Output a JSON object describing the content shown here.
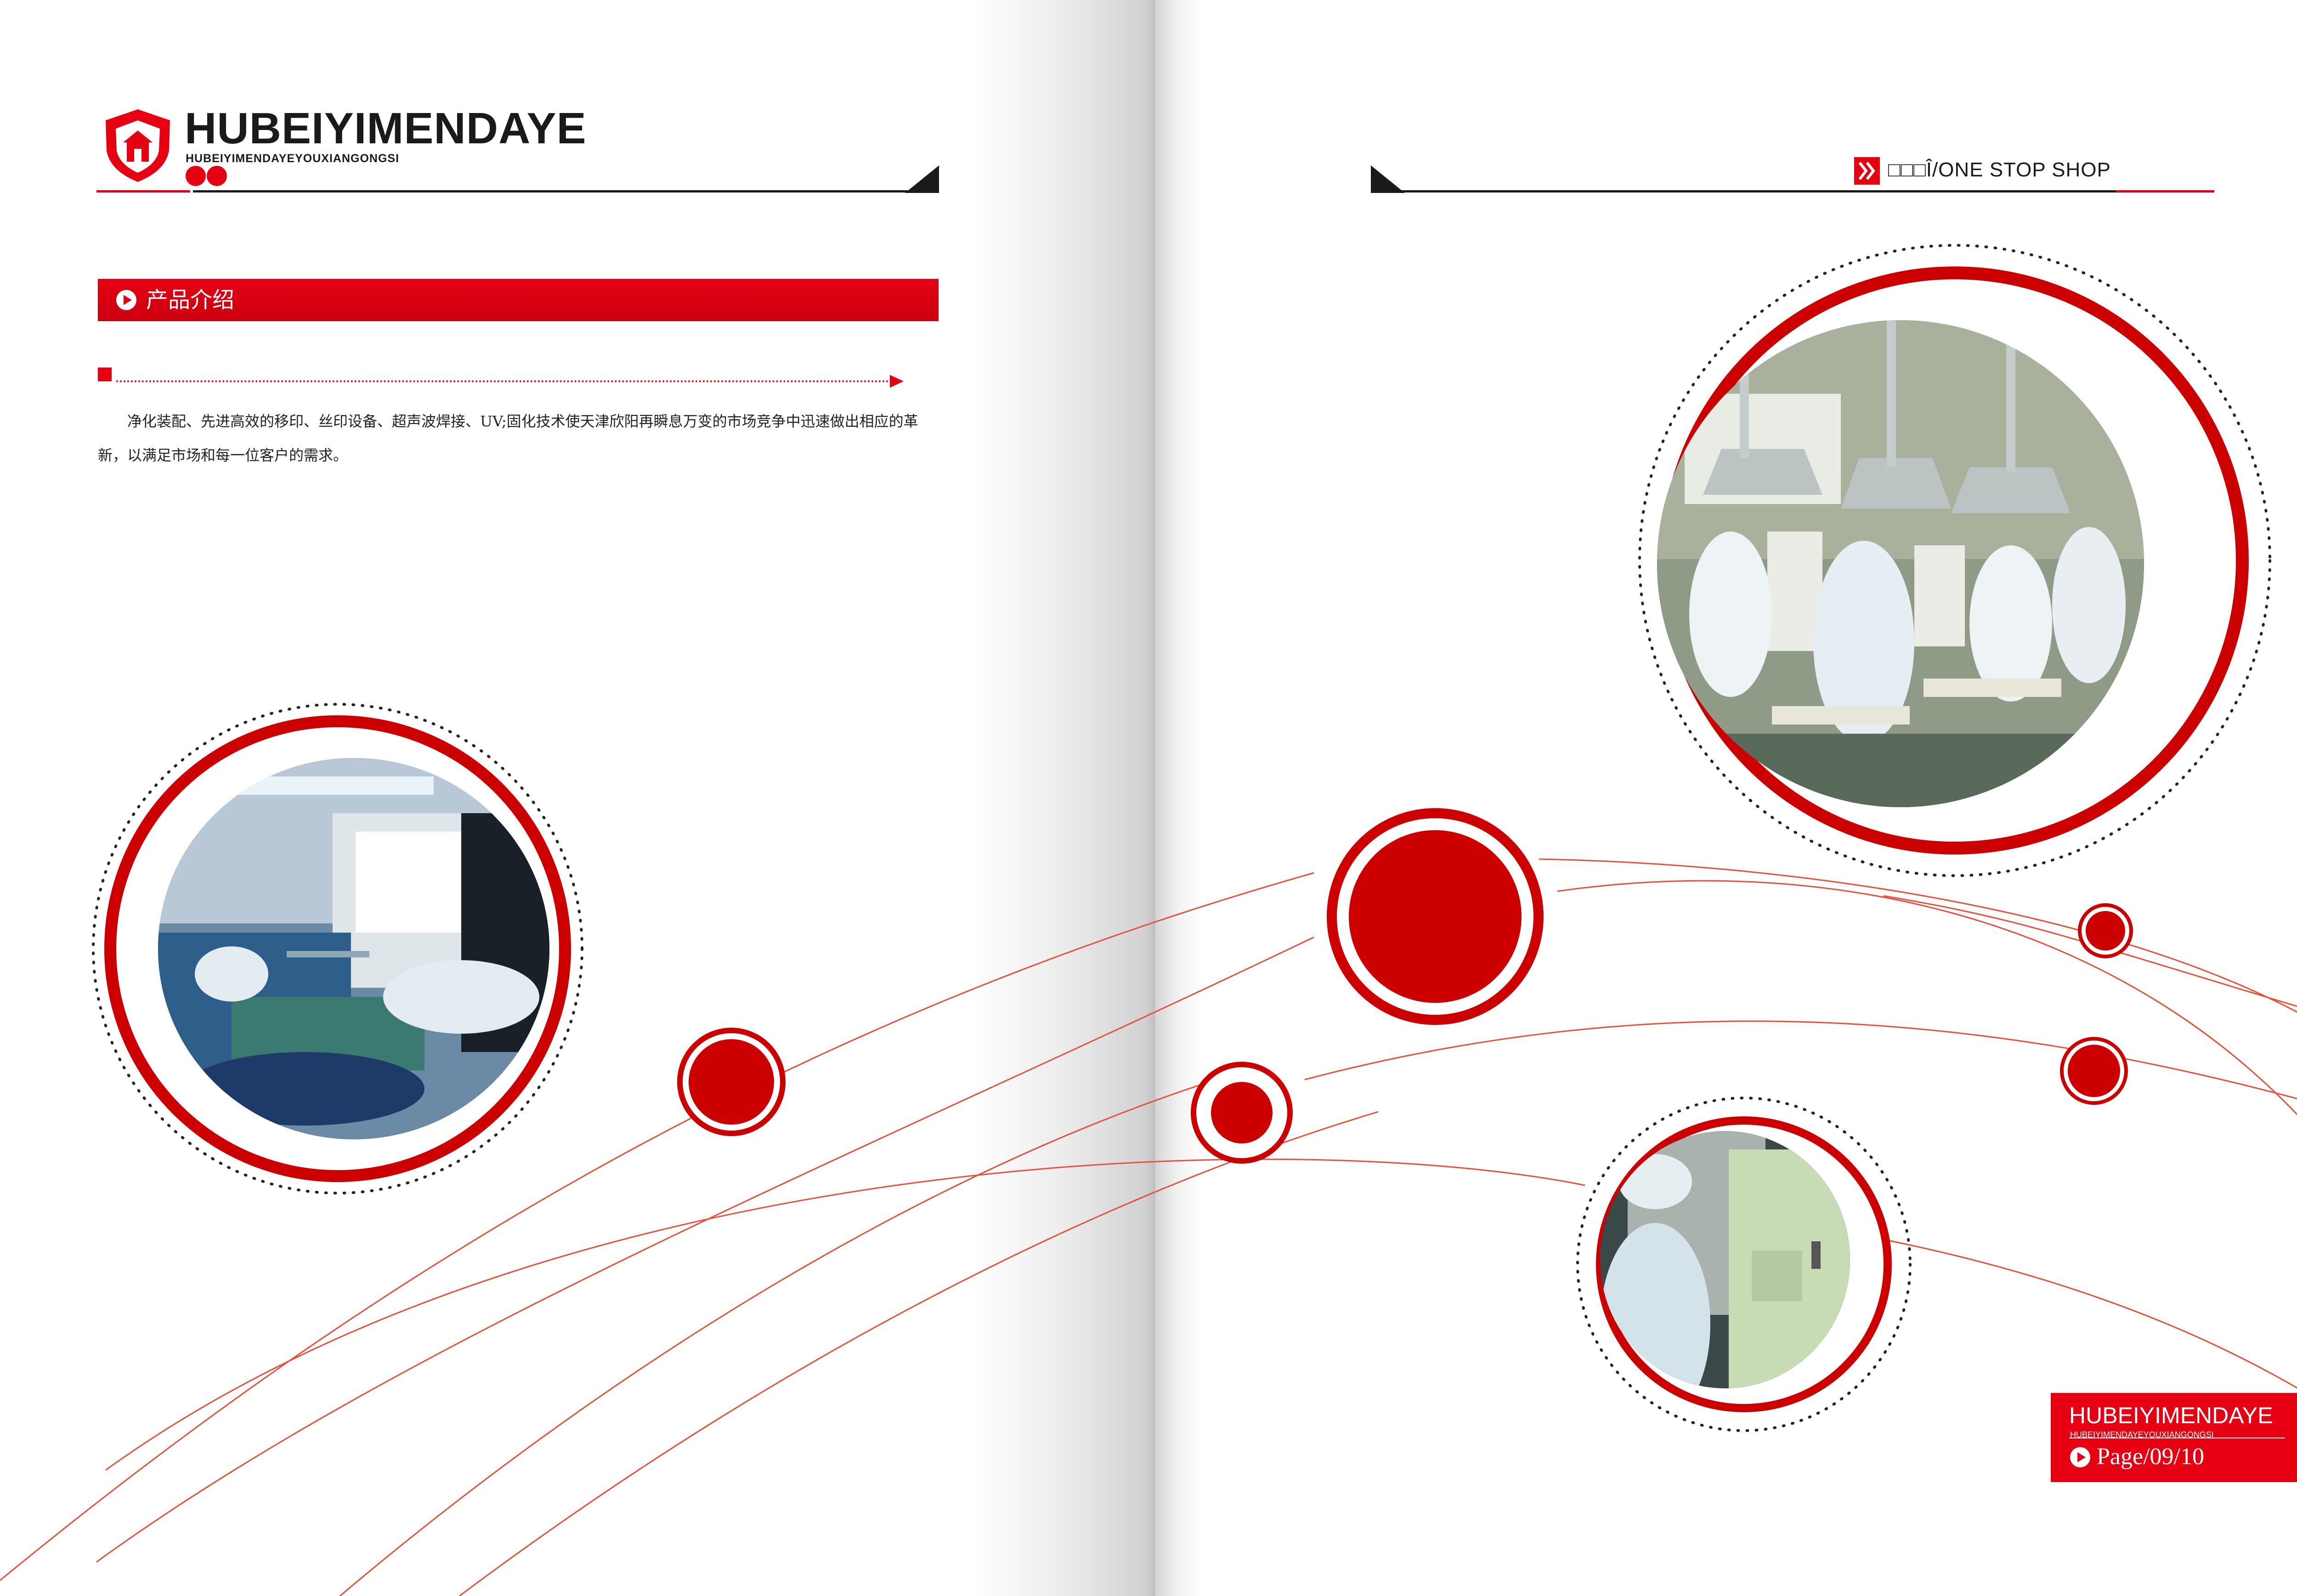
{
  "brand": {
    "name": "HUBEIYIMENDAYE",
    "tagline": "HUBEIYIMENDAYEYOUXIANGONGSI"
  },
  "section": {
    "title": "产品介绍",
    "body": "净化装配、先进高效的移印、丝印设备、超声波焊接、UV;固化技术使天津欣阳再瞬息万变的市场竞争中迅速做出相应的革新，以满足市场和每一位客户的需求。"
  },
  "header_right": {
    "label": "□□□Î/ONE STOP SHOP"
  },
  "footer": {
    "title": "HUBEIYIMENDAYE",
    "subtitle": "HUBEIYIMENDAYEYOUXIANGONGSI",
    "page": "Page/09/10"
  },
  "photos": [
    {
      "id": "cleanroom-assembly-line",
      "icon": "photo-icon"
    },
    {
      "id": "workshop-stations",
      "icon": "photo-icon"
    },
    {
      "id": "operator-at-cabinet",
      "icon": "photo-icon"
    }
  ],
  "colors": {
    "accent": "#e60012",
    "dark_red": "#cc0000",
    "text": "#1a1a1a"
  }
}
